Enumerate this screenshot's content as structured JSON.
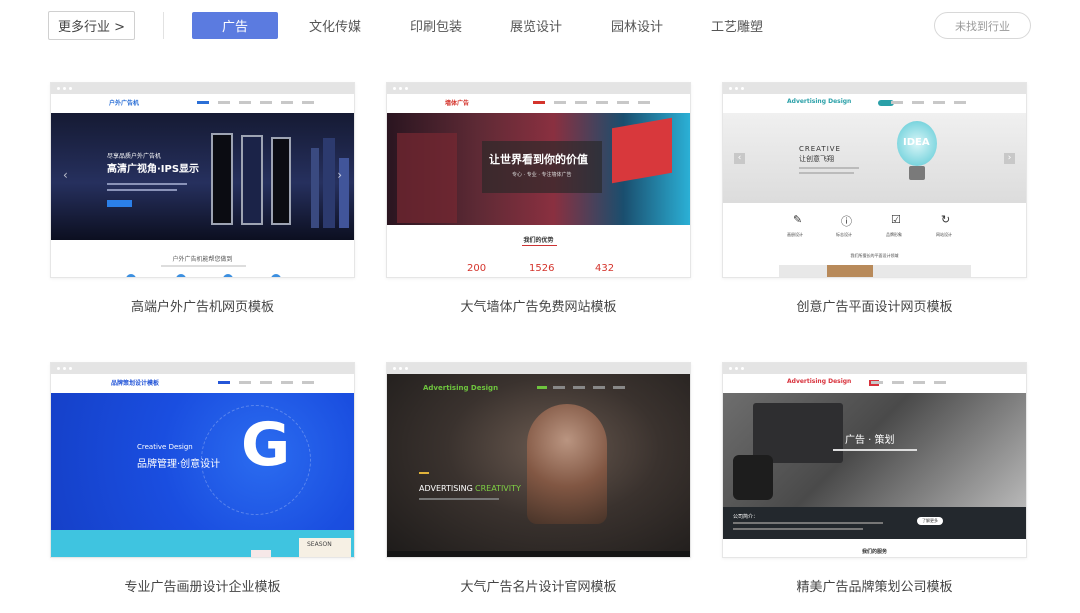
{
  "filter": {
    "more_label": "更多行业 >",
    "categories": [
      "广告",
      "文化传媒",
      "印刷包装",
      "展览设计",
      "园林设计",
      "工艺雕塑"
    ],
    "active_index": 0,
    "not_found_label": "未找到行业",
    "accent_color": "#5b7be0"
  },
  "templates": [
    {
      "title": "高端户外广告机网页模板",
      "logo": "户外广告机",
      "banner_kicker": "尽享品质户外广告机",
      "banner_headline": "高清广视角·IPS显示",
      "section_heading": "户外广告机能帮您做到"
    },
    {
      "title": "大气墙体广告免费网站模板",
      "logo": "墙体广告",
      "banner_headline": "让世界看到你的价值",
      "banner_sub": "专心 · 专业 · 专注墙体广告",
      "section_heading": "我们的优势",
      "stats": [
        "200",
        "1526",
        "432"
      ]
    },
    {
      "title": "创意广告平面设计网页模板",
      "logo": "Advertising Design",
      "banner_kicker": "CREATIVE",
      "banner_headline": "让创意飞翔",
      "bulb_text": "IDEA",
      "section_heading": "我们所擅长的平面设计领域",
      "services": [
        "画册设计",
        "标志设计",
        "品牌形象",
        "网站设计"
      ]
    },
    {
      "title": "专业广告画册设计企业模板",
      "logo": "品牌策划设计模板",
      "banner_kicker": "Creative Design",
      "banner_headline": "品牌管理·创意设计",
      "big_letter": "G",
      "season": "SEASON"
    },
    {
      "title": "大气广告名片设计官网模板",
      "logo": "Advertising Design",
      "banner_word_a": "ADVERTISING",
      "banner_word_b": "CREATIVITY"
    },
    {
      "title": "精美广告品牌策划公司模板",
      "logo": "Advertising Design",
      "banner_headline": "广告 · 策划",
      "about_heading": "公司简介：",
      "about_button": "了解更多",
      "section_heading": "我们的服务"
    }
  ]
}
